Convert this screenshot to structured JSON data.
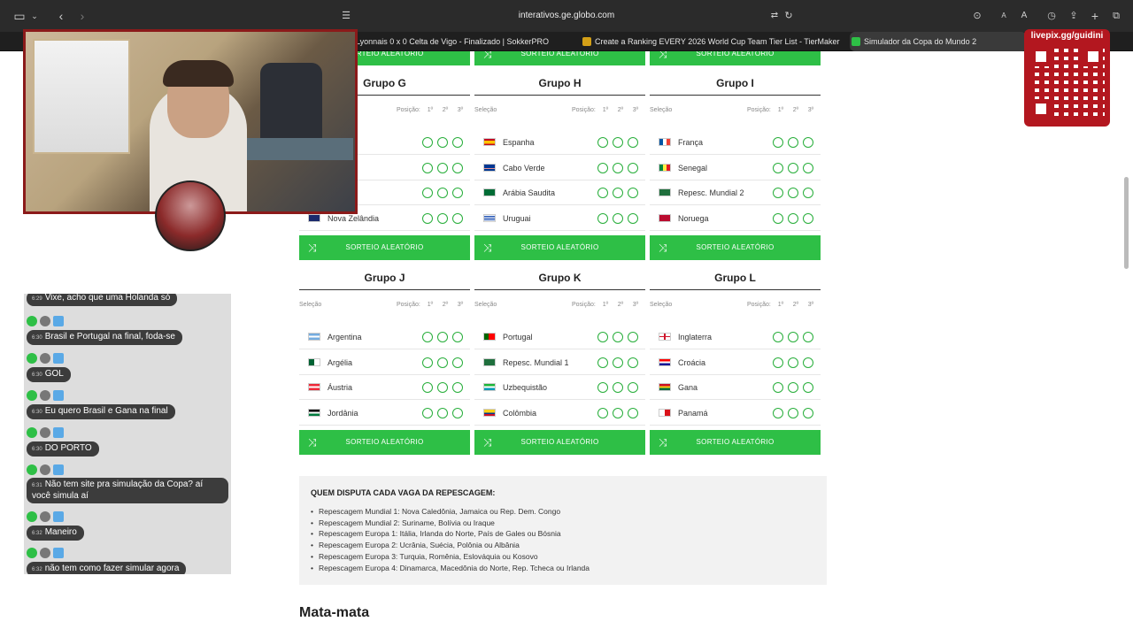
{
  "browser": {
    "url": "interativos.ge.globo.com",
    "tabs": [
      {
        "label": "Lyonnais 0 x 0 Celta de Vigo - Finalizado | SokkerPRO",
        "color": "#444"
      },
      {
        "label": "Create a Ranking EVERY 2026 World Cup Team Tier List - TierMaker",
        "color": "#d4a017"
      },
      {
        "label": "Simulador da Copa do Mundo 2",
        "color": "#2ebf46"
      }
    ]
  },
  "livepix": {
    "label": "livepix.gg/guidini"
  },
  "groups_header": {
    "selecao": "Seleção",
    "posicao": "Posição:",
    "p1": "1º",
    "p2": "2º",
    "p3": "3º"
  },
  "sorteio_label": "SORTEIO ALEATÓRIO",
  "groups": [
    {
      "name": "Grupo G",
      "teams": [
        "",
        "",
        "",
        "Nova Zelândia"
      ]
    },
    {
      "name": "Grupo H",
      "teams": [
        "Espanha",
        "Cabo Verde",
        "Arábia Saudita",
        "Uruguai"
      ]
    },
    {
      "name": "Grupo I",
      "teams": [
        "França",
        "Senegal",
        "Repesc. Mundial 2",
        "Noruega"
      ]
    },
    {
      "name": "Grupo J",
      "teams": [
        "Argentina",
        "Argélia",
        "Áustria",
        "Jordânia"
      ]
    },
    {
      "name": "Grupo K",
      "teams": [
        "Portugal",
        "Repesc. Mundial 1",
        "Uzbequistão",
        "Colômbia"
      ]
    },
    {
      "name": "Grupo L",
      "teams": [
        "Inglaterra",
        "Croácia",
        "Gana",
        "Panamá"
      ]
    }
  ],
  "repescagem": {
    "title": "QUEM DISPUTA CADA VAGA DA REPESCAGEM:",
    "items": [
      "Repescagem Mundial 1: Nova Caledônia, Jamaica ou Rep. Dem. Congo",
      "Repescagem Mundial 2: Suriname, Bolívia ou Iraque",
      "Repescagem Europa 1: Itália, Irlanda do Norte, País de Gales ou Bósnia",
      "Repescagem Europa 2: Ucrânia, Suécia, Polônia ou Albânia",
      "Repescagem Europa 3: Turquia, Romênia, Eslováquia ou Kosovo",
      "Repescagem Europa 4: Dinamarca, Macedônia do Norte, Rep. Tcheca ou Irlanda"
    ]
  },
  "section_title": "Mata-mata",
  "chat": [
    {
      "time": "6:29",
      "text": "Vixe, acho que uma Holanda só"
    },
    {
      "time": "6:30",
      "text": "Brasil e Portugal na final, foda-se"
    },
    {
      "time": "6:30",
      "text": "GOL"
    },
    {
      "time": "6:30",
      "text": "Eu quero Brasil e Gana na final"
    },
    {
      "time": "6:30",
      "text": "DO PORTO"
    },
    {
      "time": "6:31",
      "text": "Não tem site pra simulação da Copa? aí você simula aí"
    },
    {
      "time": "6:32",
      "text": "Maneiro"
    },
    {
      "time": "6:32",
      "text": "não tem como fazer simular agora"
    }
  ]
}
